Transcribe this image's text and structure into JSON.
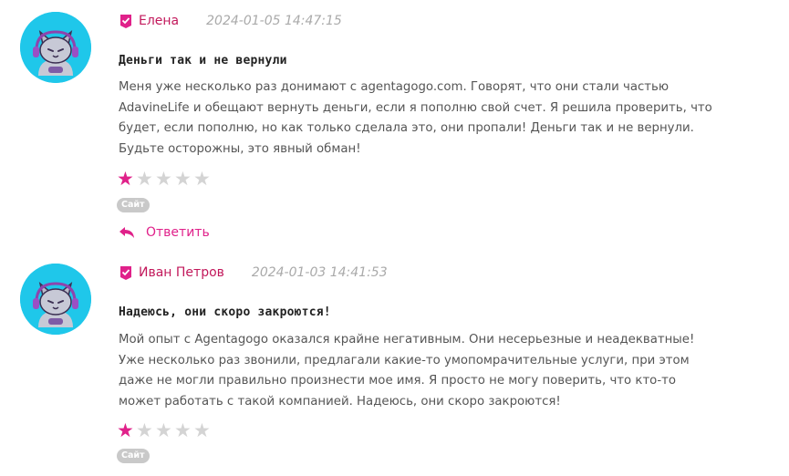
{
  "colors": {
    "accent": "#e0218a",
    "author": "#c2185b",
    "avatar_bg": "#1fc7ea",
    "star_off": "#d4d4d4",
    "badge_bg": "#c9c9c9"
  },
  "icons": {
    "verified": "check-badge-icon",
    "reply": "reply-arrow-icon",
    "avatar": "cat-gamer-avatar"
  },
  "reviews": [
    {
      "author": "Елена",
      "date": "2024-01-05 14:47:15",
      "title": "Деньги так и не вернули",
      "text": "Меня уже несколько раз донимают с agentagogo.com. Говорят, что они стали частью AdavineLife и обещают вернуть деньги, если я пополню свой счет. Я решила проверить, что будет, если пополню, но как только сделала это, они пропали! Деньги так и не вернули. Будьте осторожны, это явный обман!",
      "rating": 1,
      "rating_max": 5,
      "source_badge": "Сайт",
      "reply_label": "Ответить"
    },
    {
      "author": "Иван Петров",
      "date": "2024-01-03 14:41:53",
      "title": "Надеюсь, они скоро закроются!",
      "text": "Мой опыт с Agentagogo оказался крайне негативным. Они несерьезные и неадекватные! Уже несколько раз звонили, предлагали какие-то умопомрачительные услуги, при этом даже не могли правильно произнести мое имя. Я просто не могу поверить, что кто-то может работать с такой компанией. Надеюсь, они скоро закроются!",
      "rating": 1,
      "rating_max": 5,
      "source_badge": "Сайт"
    }
  ]
}
